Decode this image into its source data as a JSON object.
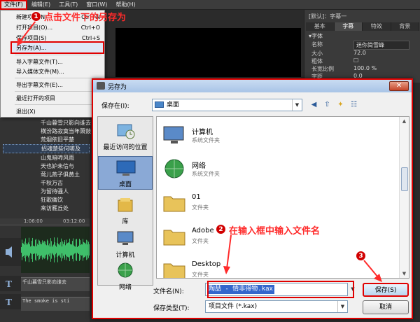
{
  "menubar": {
    "items": [
      "文件(F)",
      "编辑(E)",
      "工具(T)",
      "窗口(W)",
      "帮助(H)"
    ]
  },
  "file_menu": {
    "items": [
      {
        "label": "新建项目(N)",
        "shortcut": "Ctrl+N"
      },
      {
        "label": "打开项目(O)...",
        "shortcut": "Ctrl+O"
      },
      {
        "label": "保存项目(S)",
        "shortcut": "Ctrl+S"
      },
      {
        "label": "另存为(A)...",
        "shortcut": ""
      },
      {
        "label": "导入字幕文件(T)...",
        "shortcut": ""
      },
      {
        "label": "导入媒体文件(M)...",
        "shortcut": ""
      },
      {
        "label": "导出字幕文件(E)...",
        "shortcut": ""
      },
      {
        "label": "最近打开的项目",
        "shortcut": ""
      },
      {
        "label": "退出(X)",
        "shortcut": ""
      }
    ]
  },
  "annotations": {
    "step1_num": "1",
    "step1_text": "点击文件下的另存为",
    "step2_num": "2",
    "step2_text": "在输入框中输入文件名",
    "step3_num": "3"
  },
  "subtitles": [
    "千山暮雪只影向谁去",
    "横汾路寂寞当年箫鼓",
    "荒烟依旧平楚",
    "招魂楚些何嗟及",
    "山鬼暗啼风雨",
    "天也妒未信与",
    "莺儿燕子俱黄土",
    "千秋万古",
    "为留待骚人",
    "狂歌痛饮",
    "来访雁丘处"
  ],
  "timeline": {
    "ruler_left": "1:06:00",
    "ruler_right": "03:12:00",
    "clip1_text": "千山暮雪只影向谁去",
    "clip2_text": "The smoke is sti"
  },
  "right_panel": {
    "title": "[默认]：字幕一",
    "tabs": [
      "基本",
      "字幕",
      "特效",
      "背景"
    ],
    "section": "▾字体",
    "rows": [
      {
        "k": "名称",
        "v": "迷你简雪峰"
      },
      {
        "k": "大小",
        "v": "72.0"
      },
      {
        "k": "粗体",
        "v": "☐"
      },
      {
        "k": "长宽比例",
        "v": "100.0 %"
      },
      {
        "k": "字距",
        "v": "0.0"
      }
    ]
  },
  "dialog": {
    "title": "另存为",
    "close": "✕",
    "save_in_label": "保存在(I):",
    "save_in_value": "桌面",
    "places": [
      "最近访问的位置",
      "桌面",
      "库",
      "计算机",
      "网络"
    ],
    "files": [
      {
        "name": "计算机",
        "type": "系统文件夹"
      },
      {
        "name": "网络",
        "type": "系统文件夹"
      },
      {
        "name": "01",
        "type": "文件夹"
      },
      {
        "name": "Adobe P",
        "type": "文件夹"
      },
      {
        "name": "Desktop",
        "type": "文件夹"
      }
    ],
    "filename_label": "文件名(N):",
    "filename_value": "陶喆 - 情非得物.kax",
    "filetype_label": "保存类型(T):",
    "filetype_value": "项目文件 (*.kax)",
    "save_button": "保存(S)",
    "cancel_button": "取消"
  }
}
